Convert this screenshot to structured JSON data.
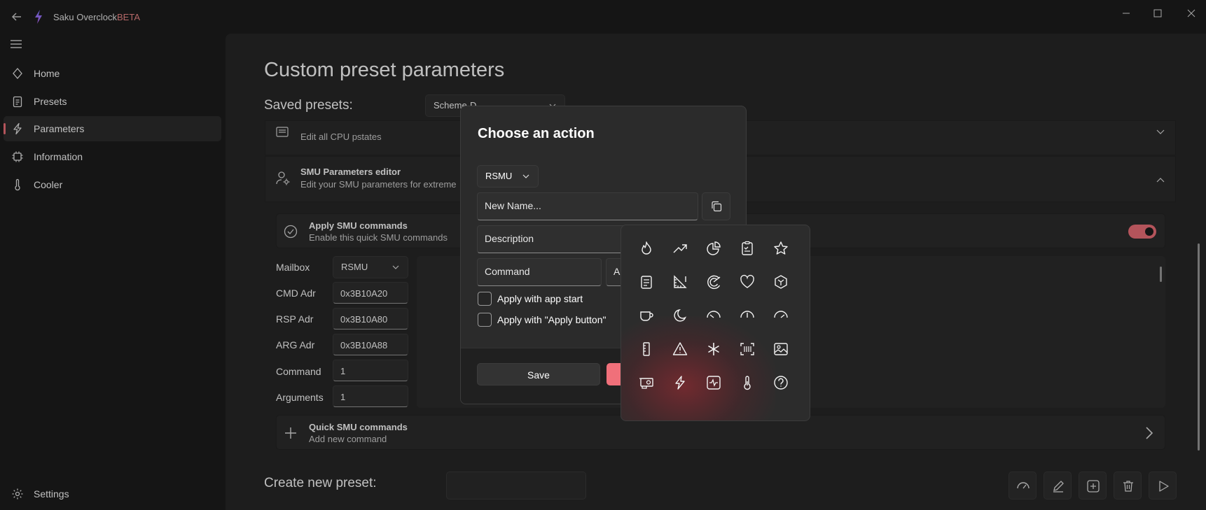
{
  "app": {
    "title": "Saku Overclock",
    "badge": "BETA"
  },
  "window_controls": {
    "minimize": "—",
    "maximize": "☐",
    "close": "✕"
  },
  "sidebar": {
    "items": [
      {
        "label": "Home",
        "icon": "home-icon"
      },
      {
        "label": "Presets",
        "icon": "clipboard-icon"
      },
      {
        "label": "Parameters",
        "icon": "lightning-icon",
        "active": true
      },
      {
        "label": "Information",
        "icon": "chip-icon"
      },
      {
        "label": "Cooler",
        "icon": "thermometer-icon"
      }
    ],
    "settings_label": "Settings"
  },
  "main": {
    "title": "Custom preset parameters",
    "saved_presets_label": "Saved presets:",
    "saved_presets_value": "Scheme-D",
    "pstates_card": {
      "subtitle": "Edit all CPU pstates"
    },
    "smu_card": {
      "title": "SMU Parameters editor",
      "subtitle": "Edit your SMU parameters for extreme"
    },
    "apply_smu": {
      "title": "Apply SMU commands",
      "subtitle": "Enable this quick SMU commands",
      "enabled": true
    },
    "fields": {
      "mailbox_label": "Mailbox",
      "mailbox_value": "RSMU",
      "cmd_label": "CMD Adr",
      "cmd_value": "0x3B10A20",
      "rsp_label": "RSP Adr",
      "rsp_value": "0x3B10A80",
      "arg_label": "ARG Adr",
      "arg_value": "0x3B10A88",
      "command_label": "Command",
      "command_value": "1",
      "arguments_label": "Arguments",
      "arguments_value": "1"
    },
    "quick_smu": {
      "title": "Quick SMU commands",
      "subtitle": "Add new command"
    },
    "create_preset_label": "Create new preset:"
  },
  "dialog": {
    "title": "Choose an action",
    "mailbox_value": "RSMU",
    "name_placeholder": "New Name...",
    "description_placeholder": "Description",
    "command_placeholder": "Command",
    "arguments_placeholder_partial": "Ar",
    "check_app_start": "Apply with app start",
    "check_apply_button": "Apply with \"Apply button\"",
    "save_label": "Save"
  },
  "icon_picker": {
    "icons": [
      "flame-icon",
      "trend-up-icon",
      "pie-chart-icon",
      "clipboard-check-icon",
      "star-icon",
      "checklist-icon",
      "ruler-measure-icon",
      "radar-icon",
      "heart-icon",
      "box-icon",
      "cup-icon",
      "moon-icon",
      "gauge-low-icon",
      "gauge-mid-icon",
      "gauge-high-icon",
      "ruler-icon",
      "warning-icon",
      "asterisk-icon",
      "scan-icon",
      "image-icon",
      "gpu-card-icon",
      "lightning-icon",
      "pulse-icon",
      "thermometer-icon",
      "help-icon"
    ]
  },
  "colors": {
    "accent": "#f0707a",
    "background": "#1c1c1c",
    "surface": "#272727"
  }
}
